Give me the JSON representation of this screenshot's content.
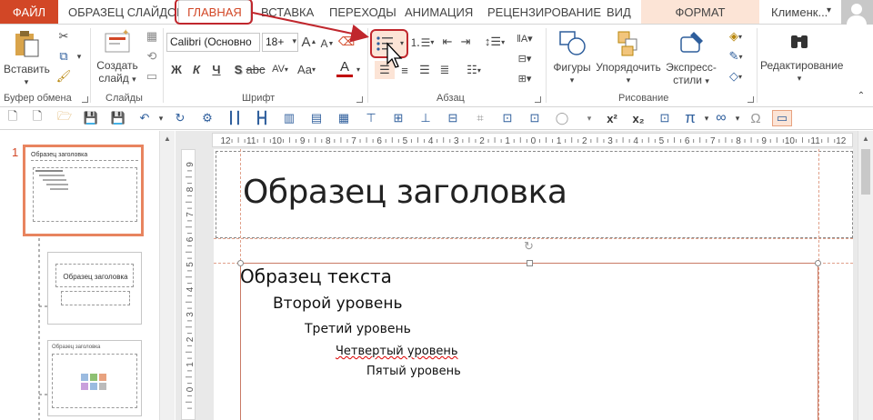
{
  "tabs": {
    "file": "ФАЙЛ",
    "items": [
      "ОБРАЗЕЦ СЛАЙДОВ",
      "ВСТАВКА",
      "ПЕРЕХОДЫ",
      "АНИМАЦИЯ",
      "РЕЦЕНЗИРОВАНИЕ",
      "ВИД"
    ],
    "active": "ГЛАВНАЯ",
    "format": "ФОРМАТ",
    "user": "Клименк..."
  },
  "ribbon": {
    "clipboard": {
      "paste": "Вставить",
      "label": "Буфер обмена"
    },
    "slides": {
      "create_line1": "Создать",
      "create_line2": "слайд",
      "label": "Слайды"
    },
    "font": {
      "name": "Calibri (Основно",
      "size": "18+",
      "bold": "Ж",
      "italic": "К",
      "underline": "Ч",
      "strike": "S",
      "spacing": "AV",
      "case": "Aa",
      "color": "A",
      "grow": "A",
      "shrink": "A",
      "label": "Шрифт"
    },
    "paragraph": {
      "label": "Абзац"
    },
    "drawing": {
      "shapes": "Фигуры",
      "arrange": "Упорядочить",
      "quick_line1": "Экспресс-",
      "quick_line2": "стили",
      "label": "Рисование"
    },
    "editing": {
      "label": "Редактирование"
    }
  },
  "qat": {
    "icons": [
      "new-icon",
      "new2-icon",
      "open-icon",
      "save-icon",
      "save-as-icon",
      "undo-icon",
      "redo-icon",
      "format-painter-icon",
      "chart1-icon",
      "chart2-icon",
      "chart3-icon",
      "chart4-icon",
      "chart5-icon",
      "align1-icon",
      "align2-icon",
      "align3-icon",
      "align4-icon",
      "crop1-icon",
      "crop2-icon",
      "crop3-icon",
      "shapes-icon",
      "superscript-icon",
      "subscript-icon",
      "fit-icon",
      "pi-icon",
      "infinity-icon",
      "omega-icon",
      "gridlines-icon"
    ],
    "superscript": "x²",
    "subscript": "x₂",
    "pi": "π",
    "infinity": "∞",
    "omega": "Ω"
  },
  "left_pane": {
    "slide_number": "1",
    "thumb1_title": "Образец заголовка",
    "thumb2_title": "Образец заголовка",
    "thumb3_title": "Образец заголовка"
  },
  "ruler": {
    "h_ticks": [
      "12",
      "11",
      "10",
      "9",
      "8",
      "7",
      "6",
      "5",
      "4",
      "3",
      "2",
      "1",
      "0",
      "1",
      "2",
      "3",
      "4",
      "5",
      "6",
      "7",
      "8",
      "9",
      "10",
      "11",
      "12"
    ],
    "v_ticks": [
      "9",
      "8",
      "7",
      "6",
      "5",
      "4",
      "3",
      "2",
      "1",
      "0"
    ]
  },
  "slide": {
    "title": "Образец заголовка",
    "level1": "Образец текста",
    "level2": "Второй уровень",
    "level3": "Третий уровень",
    "level4": "Четвертый уровень",
    "level5": "Пятый уровень"
  },
  "colors": {
    "accent": "#d24726",
    "highlight": "#c0272d",
    "format_tab": "#fce4d6"
  }
}
